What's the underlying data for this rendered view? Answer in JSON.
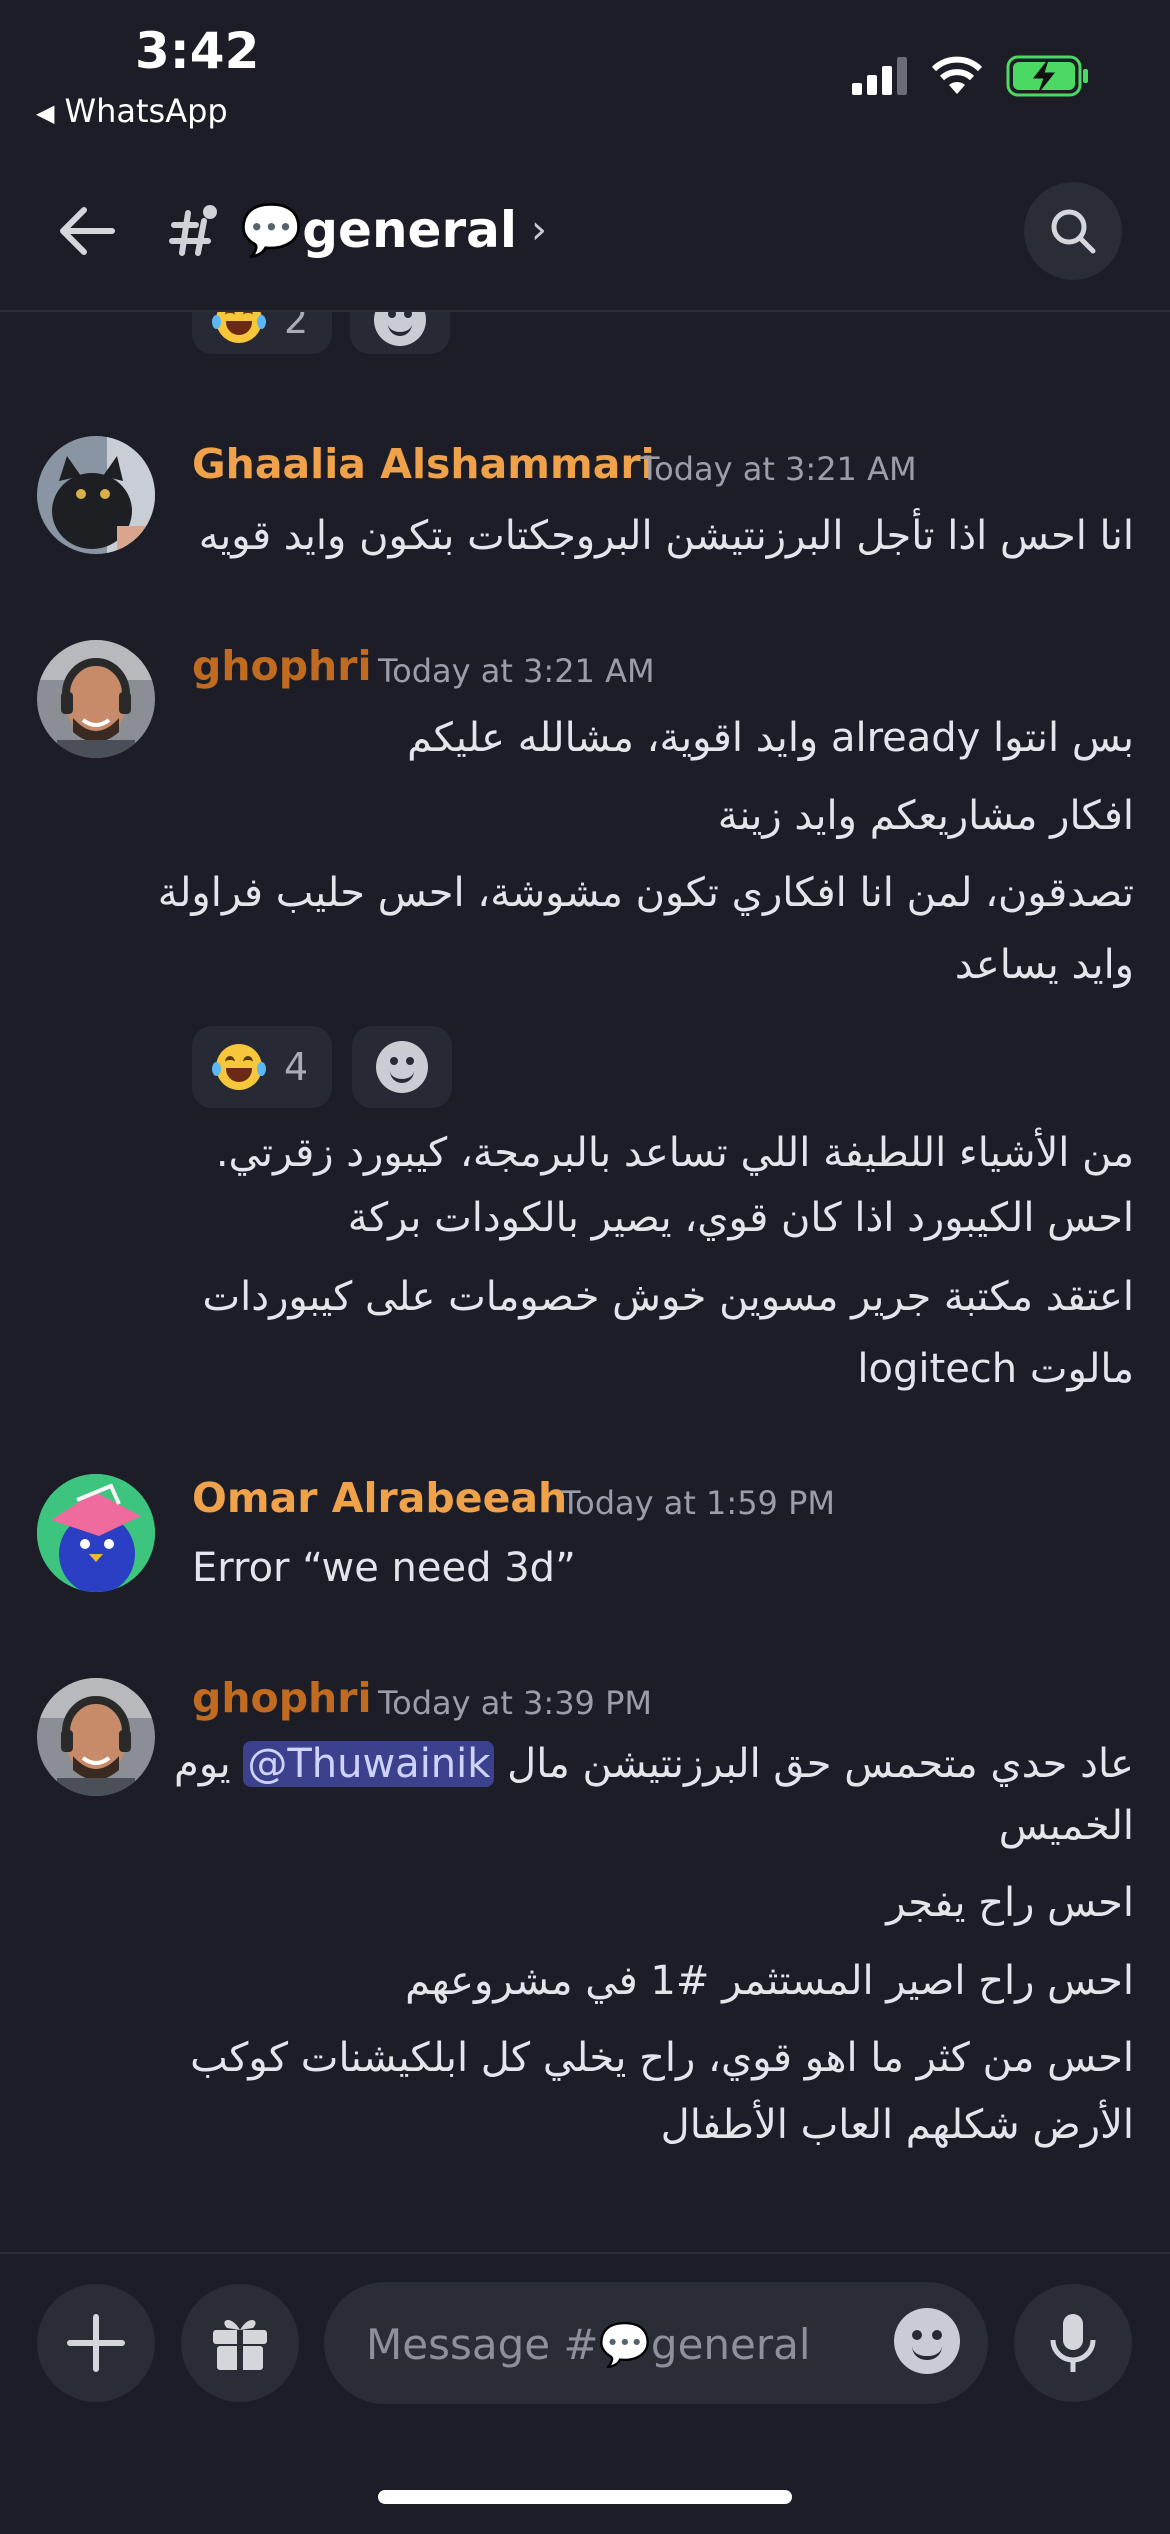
{
  "status_bar": {
    "time": "3:42",
    "back_app": "WhatsApp"
  },
  "header": {
    "channel_icon": "hash-icon",
    "channel_name": "💬general",
    "chevron": "›"
  },
  "messages": [
    {
      "reactions": [
        {
          "emoji": "😂",
          "count": "2"
        }
      ]
    },
    {
      "author": "Ghaalia Alshammari",
      "author_color": "#f0a24a",
      "timestamp": "Today at 3:21 AM",
      "lines": [
        "انا احس اذا تأجل البرزنتيشن البروجكتات بتكون وايد قويه"
      ]
    },
    {
      "author": "ghophri",
      "author_color": "#c06b1f",
      "timestamp": "Today at 3:21 AM",
      "lines": [
        "بس انتوا already وايد اقوية، مشالله عليكم",
        "افكار مشاريعكم وايد زينة",
        "تصدقون، لمن انا افكاري تكون مشوشة، احس حليب فراولة",
        "وايد يساعد",
        "من الأشياء اللطيفة اللي تساعد بالبرمجة، كيبورد زقرتي.",
        "احس الكيبورد اذا كان قوي، يصير بالكودات بركة",
        "اعتقد مكتبة جرير مسوين خوش خصومات على كيبوردات",
        "مالوت logitech"
      ],
      "reactions": [
        {
          "emoji": "😂",
          "count": "4"
        }
      ]
    },
    {
      "author": "Omar Alrabeeah",
      "author_color": "#f0a24a",
      "timestamp": "Today at 1:59 PM",
      "lines": [
        "Error “we need 3d”"
      ]
    },
    {
      "author": "ghophri",
      "author_color": "#c06b1f",
      "timestamp": "Today at 3:39 PM",
      "line1_before": "عاد حدي متحمس حق البرزنتيشن مال",
      "mention": "@Thuwainik",
      "line1_after": "يوم",
      "lines": [
        "الخميس",
        "احس راح يفجر",
        "احس راح اصير المستثمر #1 في مشروعهم",
        "احس من كثر ما اهو قوي، راح يخلي كل ابلكيشنات كوكب",
        "الأرض شكلهم العاب الأطفال"
      ]
    }
  ],
  "composer": {
    "placeholder": "Message #💬general"
  },
  "colors": {
    "background": "#1c1d26",
    "mention_bg": "#3c418e"
  }
}
